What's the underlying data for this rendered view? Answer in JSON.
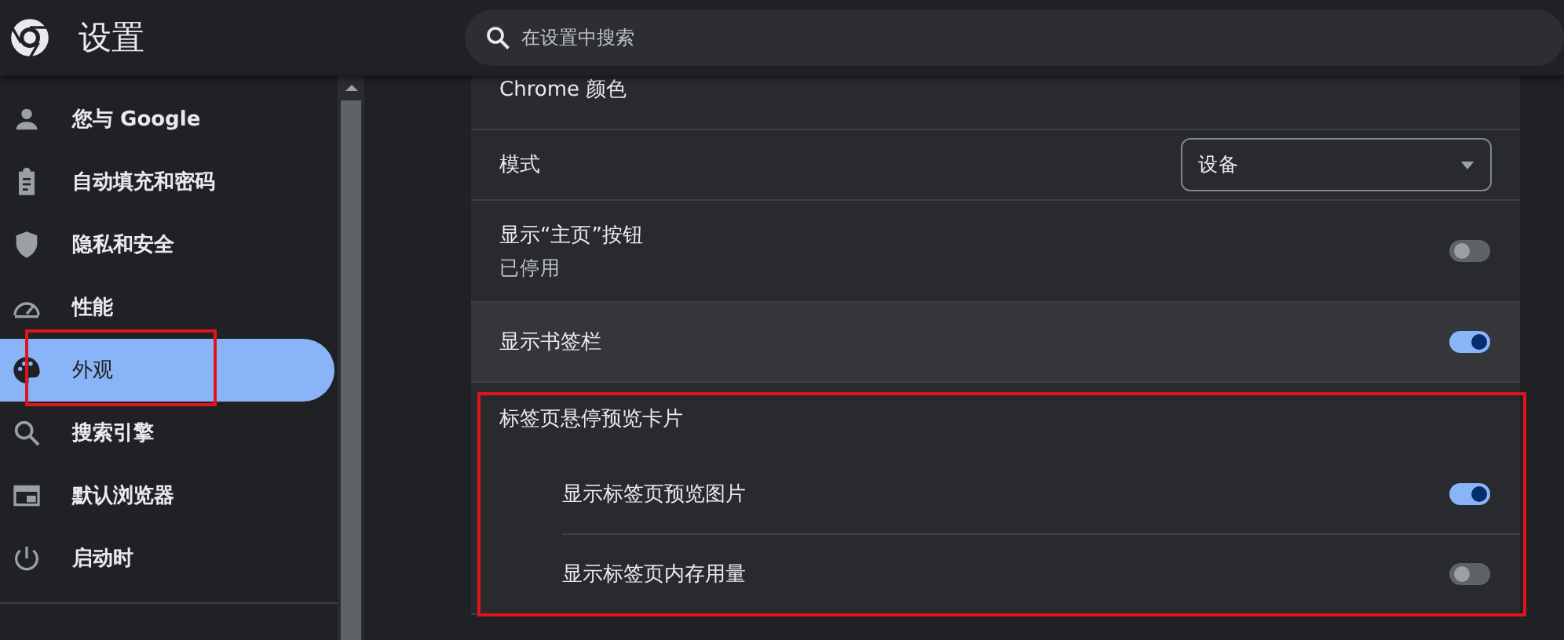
{
  "header": {
    "title": "设置",
    "search": {
      "placeholder": "在设置中搜索"
    }
  },
  "sidebar": {
    "items": [
      {
        "label": "您与 Google",
        "selected": false,
        "highlighted": false
      },
      {
        "label": "自动填充和密码",
        "selected": false,
        "highlighted": false
      },
      {
        "label": "隐私和安全",
        "selected": false,
        "highlighted": false
      },
      {
        "label": "性能",
        "selected": false,
        "highlighted": false
      },
      {
        "label": "外观",
        "selected": true,
        "highlighted": true
      },
      {
        "label": "搜索引擎",
        "selected": false,
        "highlighted": false
      },
      {
        "label": "默认浏览器",
        "selected": false,
        "highlighted": false
      },
      {
        "label": "启动时",
        "selected": false,
        "highlighted": false
      }
    ]
  },
  "settings": [
    {
      "kind": "label",
      "label": "Chrome 颜色"
    },
    {
      "kind": "select",
      "label": "模式",
      "value": "设备"
    },
    {
      "kind": "toggle",
      "label": "显示“主页”按钮",
      "sublabel": "已停用",
      "on": false,
      "hovered": false
    },
    {
      "kind": "toggle",
      "label": "显示书签栏",
      "on": true,
      "hovered": true
    },
    {
      "kind": "group",
      "label": "标签页悬停预览卡片",
      "highlighted": true,
      "children": [
        {
          "label": "显示标签页预览图片",
          "on": true
        },
        {
          "label": "显示标签页内存用量",
          "on": false
        }
      ]
    }
  ]
}
